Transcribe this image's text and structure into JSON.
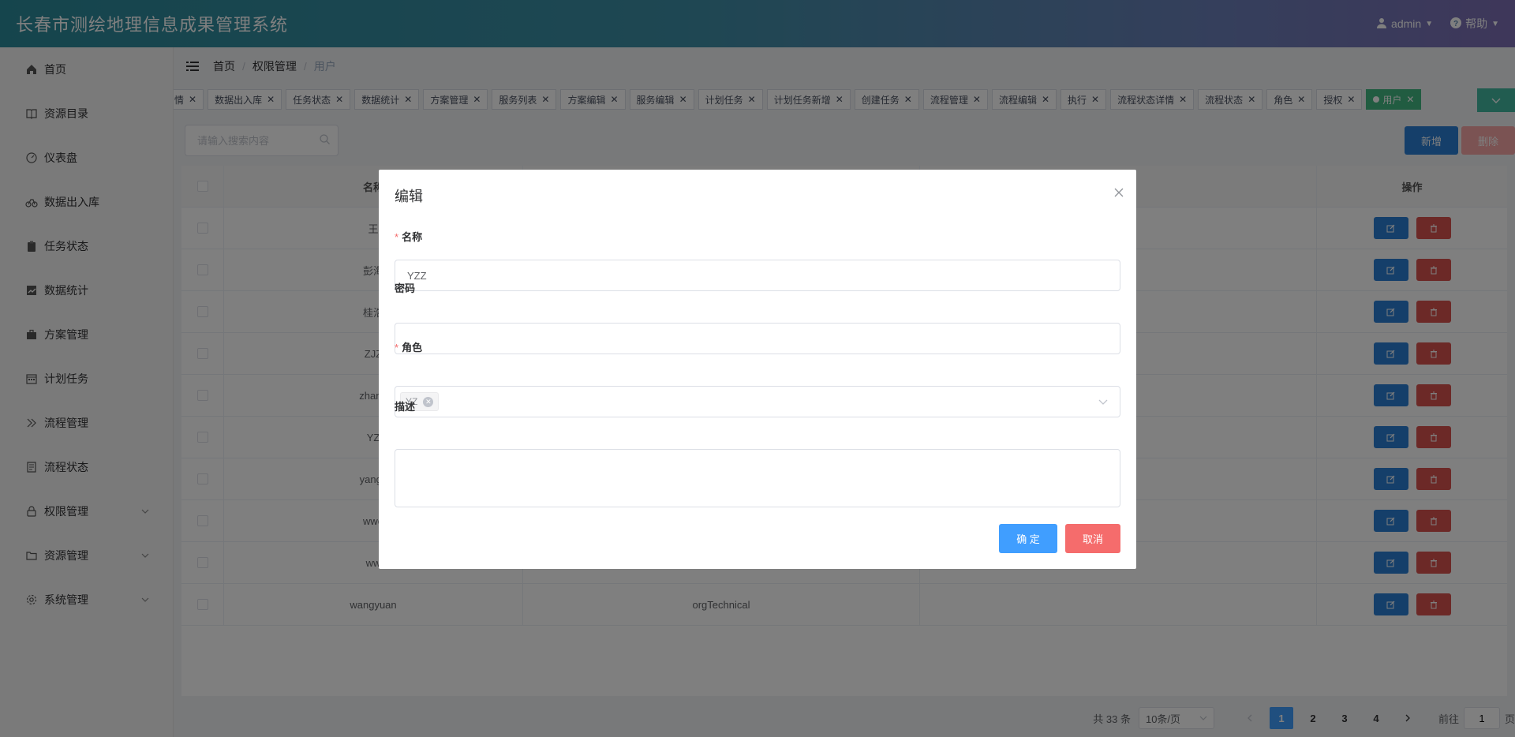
{
  "header": {
    "title": "长春市测绘地理信息成果管理系统",
    "user": "admin",
    "help": "帮助"
  },
  "sidebar": {
    "items": [
      {
        "label": "首页",
        "icon": "home-icon"
      },
      {
        "label": "资源目录",
        "icon": "book-icon"
      },
      {
        "label": "仪表盘",
        "icon": "dashboard-icon"
      },
      {
        "label": "数据出入库",
        "icon": "bicycle-icon"
      },
      {
        "label": "任务状态",
        "icon": "clipboard-icon"
      },
      {
        "label": "数据统计",
        "icon": "chart-icon"
      },
      {
        "label": "方案管理",
        "icon": "briefcase-icon"
      },
      {
        "label": "计划任务",
        "icon": "calendar-icon"
      },
      {
        "label": "流程管理",
        "icon": "double-chevron-icon"
      },
      {
        "label": "流程状态",
        "icon": "document-icon"
      },
      {
        "label": "权限管理",
        "icon": "lock-icon"
      },
      {
        "label": "资源管理",
        "icon": "folder-icon"
      },
      {
        "label": "系统管理",
        "icon": "gear-icon"
      }
    ]
  },
  "breadcrumb": [
    "首页",
    "权限管理",
    "用户"
  ],
  "tags": [
    "情",
    "数据出入库",
    "任务状态",
    "数据统计",
    "方案管理",
    "服务列表",
    "方案编辑",
    "服务编辑",
    "计划任务",
    "计划任务新增",
    "创建任务",
    "流程管理",
    "流程编辑",
    "执行",
    "流程状态详情",
    "流程状态",
    "角色",
    "授权"
  ],
  "active_tag": "用户",
  "search": {
    "placeholder": "请输入搜索内容"
  },
  "toolbar": {
    "add_label": "新增",
    "delete_label": "删除"
  },
  "table": {
    "headers": {
      "name": "名称",
      "operation": "操作"
    },
    "rows": [
      {
        "name": "王",
        "role": "",
        "desc": ""
      },
      {
        "name": "彭海",
        "role": "",
        "desc": ""
      },
      {
        "name": "桂浩",
        "role": "",
        "desc": ""
      },
      {
        "name": "ZJZ",
        "role": "",
        "desc": ""
      },
      {
        "name": "zhang",
        "role": "",
        "desc": ""
      },
      {
        "name": "YZ",
        "role": "",
        "desc": ""
      },
      {
        "name": "yangx",
        "role": "",
        "desc": ""
      },
      {
        "name": "wwe",
        "role": "",
        "desc": ""
      },
      {
        "name": "ww",
        "role": "",
        "desc": ""
      },
      {
        "name": "wangyuan",
        "role": "orgTechnical",
        "desc": ""
      }
    ]
  },
  "pagination": {
    "total": "共 33 条",
    "page_size": "10条/页",
    "pages": [
      "1",
      "2",
      "3",
      "4"
    ],
    "current": "1",
    "goto_prefix": "前往",
    "goto_value": "1",
    "goto_suffix": "页"
  },
  "modal": {
    "title": "编辑",
    "name_label": "名称",
    "name_value": "YZZ",
    "password_label": "密码",
    "password_value": "",
    "role_label": "角色",
    "role_chip": "YZ",
    "desc_label": "描述",
    "desc_value": "",
    "ok_label": "确 定",
    "cancel_label": "取消"
  },
  "colors": {
    "primary": "#409eff",
    "danger": "#f56c6c",
    "tag_active": "#42b983"
  }
}
